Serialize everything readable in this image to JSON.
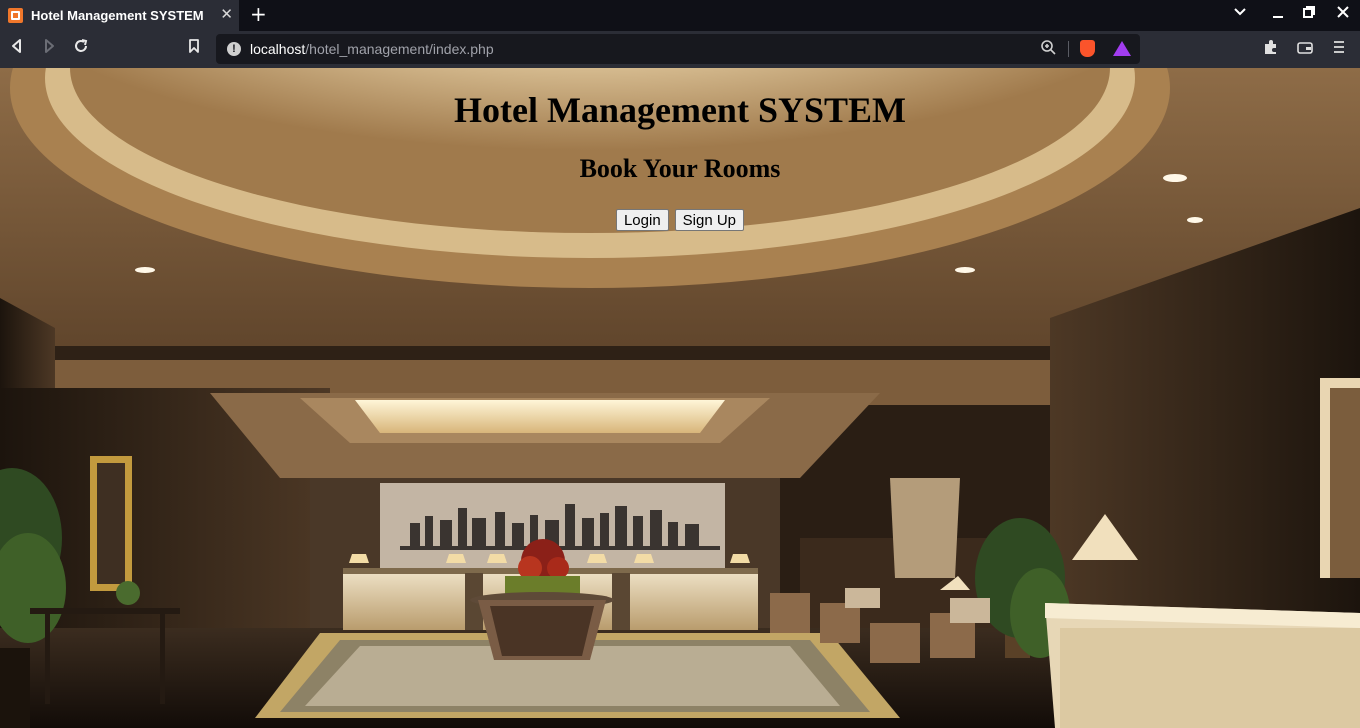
{
  "browser": {
    "tab_title": "Hotel Management SYSTEM",
    "tab_close": "✕",
    "new_tab": "+",
    "url_host": "localhost",
    "url_path": "/hotel_management/index.php"
  },
  "page": {
    "title": "Hotel Management SYSTEM",
    "subtitle": "Book Your Rooms",
    "buttons": {
      "login": "Login",
      "signup": "Sign Up"
    }
  },
  "colors": {
    "tab_active": "#2b2d36",
    "tabbar": "#0f1017",
    "urlbar": "#17181e",
    "favicon": "#f0772b",
    "brave": "#fb542b"
  },
  "icons": [
    "favicon-icon",
    "close-icon",
    "plus-icon",
    "chevron-down-icon",
    "minimize-icon",
    "restore-icon",
    "close-window-icon",
    "back-icon",
    "forward-icon",
    "reload-icon",
    "bookmark-icon",
    "info-icon",
    "zoom-icon",
    "brave-shields-icon",
    "brave-rewards-icon",
    "extensions-icon",
    "wallet-icon",
    "menu-icon"
  ]
}
